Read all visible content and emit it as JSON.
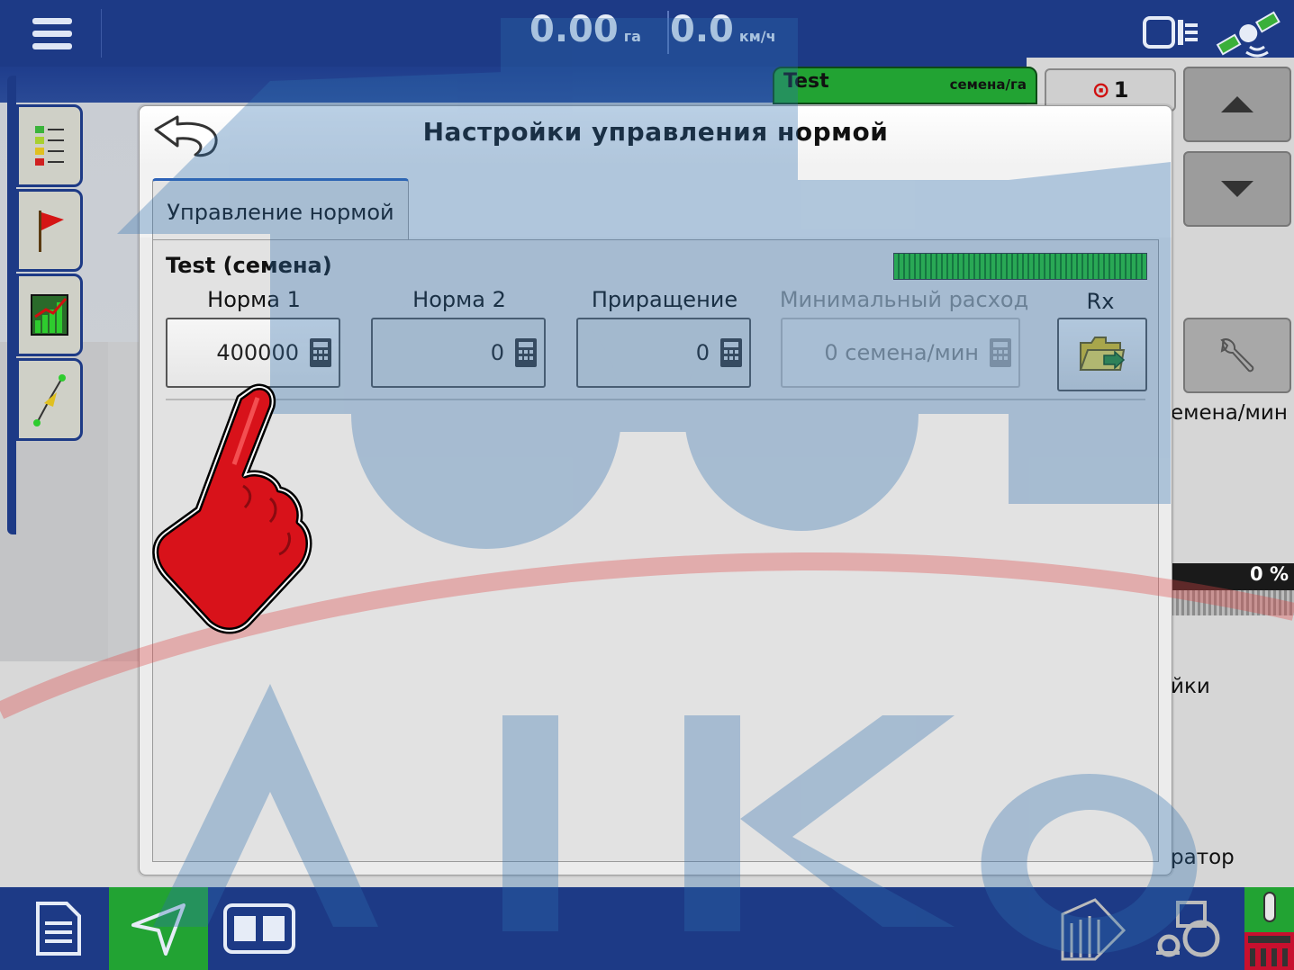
{
  "topbar": {
    "area_value": "0.00",
    "area_unit": "га",
    "speed_value": "0.0",
    "speed_unit": "км/ч"
  },
  "product": {
    "name": "Test",
    "unit": "семена/га"
  },
  "target": {
    "count": "1"
  },
  "right_panel": {
    "rate_unit_partial": "емена/мин",
    "progress_percent": "0 %",
    "settings_partial": "йки",
    "operator_partial": "ратор"
  },
  "dialog": {
    "title": "Настройки управления нормой",
    "tab_label": "Управление нормой",
    "product_label": "Test (семена)",
    "columns": [
      {
        "label": "Норма 1",
        "value": "400000"
      },
      {
        "label": "Норма 2",
        "value": "0"
      },
      {
        "label": "Приращение",
        "value": "0"
      },
      {
        "label": "Минимальный расход",
        "value": "0 семена/мин"
      }
    ],
    "rx_label": "Rx"
  },
  "watermark": {
    "text": "AIKO"
  },
  "colors": {
    "brand_blue": "#1d3a86",
    "product_green": "#22a333",
    "pointer_red": "#d8121a"
  }
}
